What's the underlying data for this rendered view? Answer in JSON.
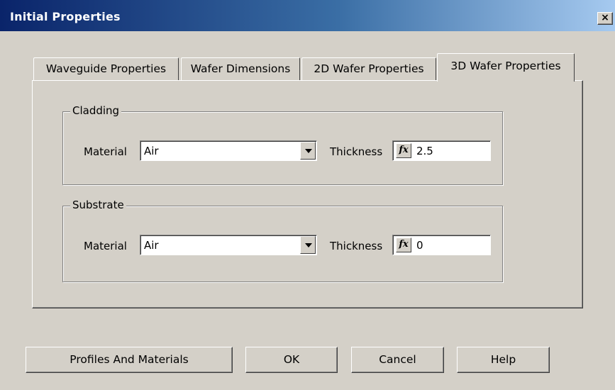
{
  "window": {
    "title": "Initial Properties",
    "close_glyph": "×",
    "close_icon": "close-icon"
  },
  "tabs": [
    {
      "label": "Waveguide Properties",
      "active": false
    },
    {
      "label": "Wafer Dimensions",
      "active": false
    },
    {
      "label": "2D Wafer Properties",
      "active": false
    },
    {
      "label": "3D Wafer Properties",
      "active": true
    }
  ],
  "cladding": {
    "title": "Cladding",
    "material_label": "Material",
    "material_value": "Air",
    "thickness_label": "Thickness",
    "fx_icon": "function-icon",
    "fx_glyph": "fx",
    "thickness_value": "2.5"
  },
  "substrate": {
    "title": "Substrate",
    "material_label": "Material",
    "material_value": "Air",
    "thickness_label": "Thickness",
    "fx_icon": "function-icon",
    "fx_glyph": "fx",
    "thickness_value": "0"
  },
  "buttons": {
    "profiles": "Profiles And Materials",
    "ok": "OK",
    "cancel": "Cancel",
    "help": "Help"
  },
  "colors": {
    "titlebar_start": "#0a246a",
    "titlebar_end": "#a6caf0",
    "face": "#d4d0c8"
  }
}
